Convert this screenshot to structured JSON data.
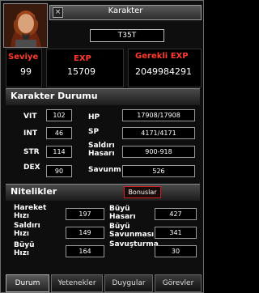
{
  "window": {
    "title": "Karakter",
    "close_glyph": "×",
    "character_name": "T35T"
  },
  "top_stats": [
    {
      "label": "Seviye",
      "value": "99"
    },
    {
      "label": "EXP",
      "value": "15709"
    },
    {
      "label": "Gerekli EXP",
      "value": "2049984291"
    }
  ],
  "character_status": {
    "title": "Karakter Durumu",
    "left": [
      {
        "label": "VIT",
        "value": "102"
      },
      {
        "label": "INT",
        "value": "46"
      },
      {
        "label": "STR",
        "value": "114"
      },
      {
        "label": "DEX",
        "value": "90"
      }
    ],
    "right": [
      {
        "label": "HP",
        "value": "17908/17908"
      },
      {
        "label": "SP",
        "value": "4171/4171"
      },
      {
        "label": "Saldırı Hasarı",
        "value": "900-918"
      },
      {
        "label": "Savunma",
        "value": "526"
      }
    ]
  },
  "attributes": {
    "title": "Nitelikler",
    "bonus_button": "Bonuslar",
    "left": [
      {
        "label": "Hareket Hızı",
        "value": "197"
      },
      {
        "label": "Saldırı Hızı",
        "value": "149"
      },
      {
        "label": "Büyü Hızı",
        "value": "164"
      }
    ],
    "right": [
      {
        "label": "Büyü Hasarı",
        "value": "427"
      },
      {
        "label": "Büyü Savunması",
        "value": "341"
      },
      {
        "label": "Savuşturma",
        "value": "30"
      }
    ]
  },
  "tabs": [
    "Durum",
    "Yetenekler",
    "Duygular",
    "Görevler"
  ],
  "colors": {
    "accent_red": "#ff3a2a",
    "bonus_border": "#d02020"
  }
}
